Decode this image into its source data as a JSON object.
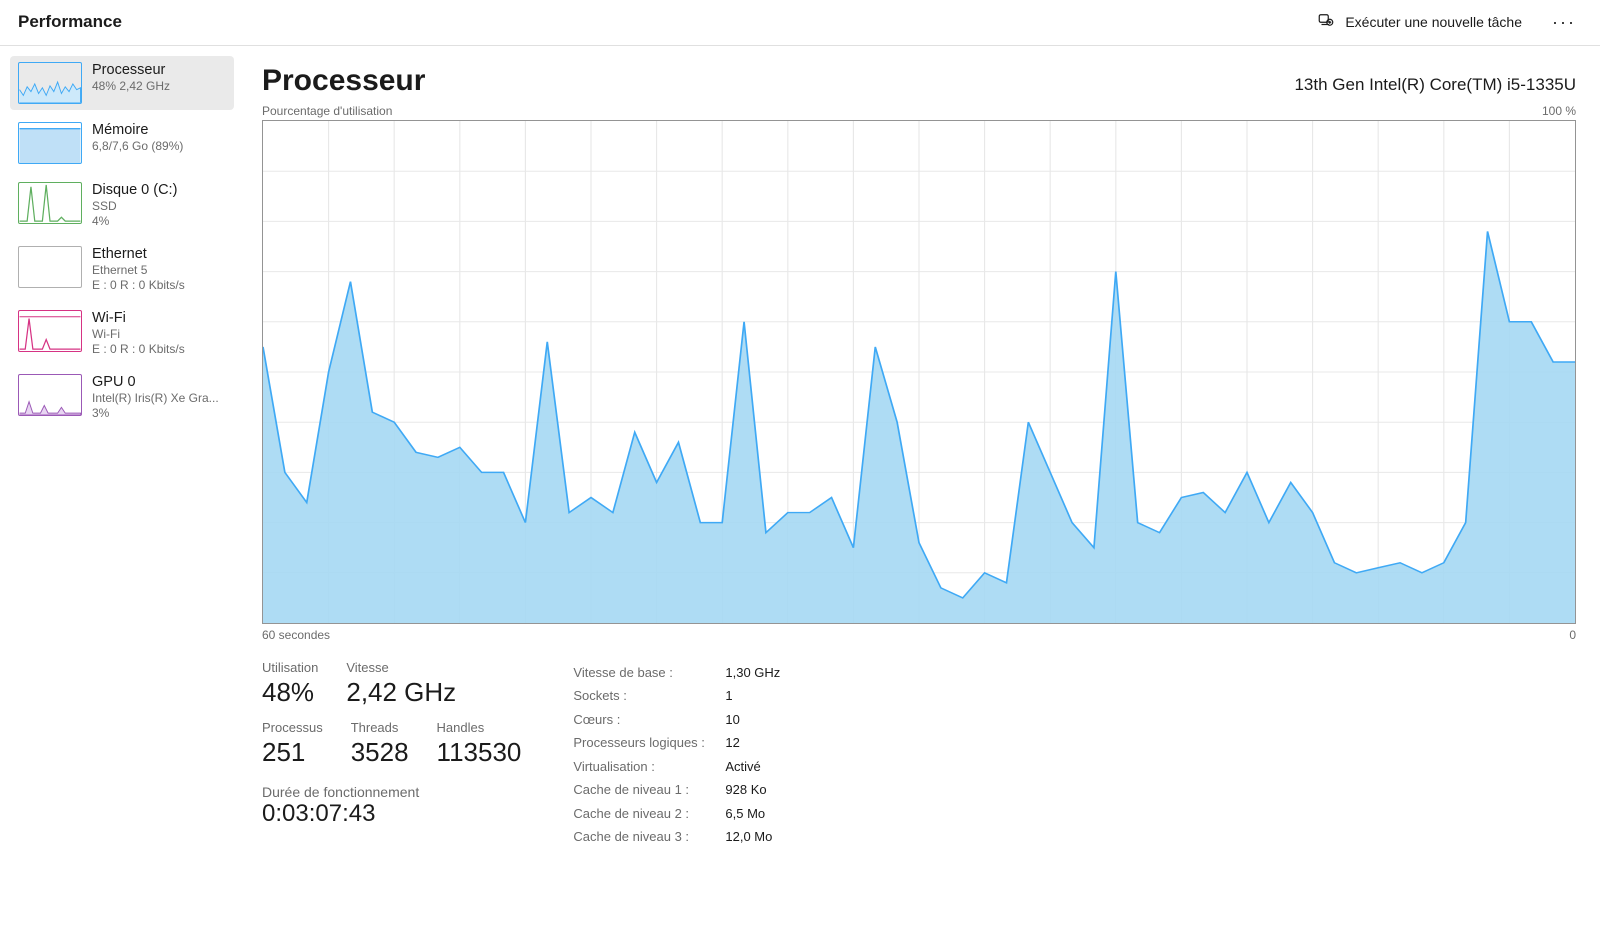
{
  "header": {
    "title": "Performance",
    "run_task_label": "Exécuter une nouvelle tâche",
    "more_label": "···"
  },
  "sidebar": [
    {
      "id": "cpu",
      "title": "Processeur",
      "sub1": "48%  2,42 GHz",
      "sub2": null,
      "selected": true,
      "thumb_border": "#3fa9f5",
      "thumb_kind": "cpu"
    },
    {
      "id": "memory",
      "title": "Mémoire",
      "sub1": "6,8/7,6 Go (89%)",
      "sub2": null,
      "selected": false,
      "thumb_border": "#3fa9f5",
      "thumb_kind": "memory"
    },
    {
      "id": "disk0",
      "title": "Disque 0 (C:)",
      "sub1": "SSD",
      "sub2": "4%",
      "selected": false,
      "thumb_border": "#5faf5f",
      "thumb_kind": "disk"
    },
    {
      "id": "ethernet",
      "title": "Ethernet",
      "sub1": "Ethernet 5",
      "sub2": "E : 0 R : 0 Kbits/s",
      "selected": false,
      "thumb_border": "#b0b0b0",
      "thumb_kind": "empty"
    },
    {
      "id": "wifi",
      "title": "Wi-Fi",
      "sub1": "Wi-Fi",
      "sub2": "E : 0 R : 0 Kbits/s",
      "selected": false,
      "thumb_border": "#d63384",
      "thumb_kind": "wifi"
    },
    {
      "id": "gpu0",
      "title": "GPU 0",
      "sub1": "Intel(R) Iris(R) Xe Gra...",
      "sub2": "3%",
      "selected": false,
      "thumb_border": "#9b59b6",
      "thumb_kind": "gpu"
    }
  ],
  "main": {
    "title": "Processeur",
    "subtitle": "13th Gen Intel(R) Core(TM) i5-1335U",
    "chart": {
      "top_left_label": "Pourcentage d'utilisation",
      "top_right_label": "100 %",
      "bottom_left_label": "60 secondes",
      "bottom_right_label": "0"
    },
    "big_stats_row1": [
      {
        "label": "Utilisation",
        "value": "48%"
      },
      {
        "label": "Vitesse",
        "value": "2,42 GHz"
      }
    ],
    "big_stats_row2": [
      {
        "label": "Processus",
        "value": "251"
      },
      {
        "label": "Threads",
        "value": "3528"
      },
      {
        "label": "Handles",
        "value": "113530"
      }
    ],
    "uptime_label": "Durée de fonctionnement",
    "uptime_value": "0:03:07:43",
    "detail_stats": [
      {
        "label": "Vitesse de base :",
        "value": "1,30 GHz"
      },
      {
        "label": "Sockets :",
        "value": "1"
      },
      {
        "label": "Cœurs :",
        "value": "10"
      },
      {
        "label": "Processeurs logiques :",
        "value": "12"
      },
      {
        "label": "Virtualisation :",
        "value": "Activé"
      },
      {
        "label": "Cache de niveau 1 :",
        "value": "928 Ko"
      },
      {
        "label": "Cache de niveau 2 :",
        "value": "6,5 Mo"
      },
      {
        "label": "Cache de niveau 3 :",
        "value": "12,0 Mo"
      }
    ]
  },
  "chart_data": {
    "type": "area",
    "title": "Pourcentage d'utilisation",
    "xlabel": "secondes",
    "ylabel": "Pourcentage d'utilisation",
    "xlim": [
      60,
      0
    ],
    "ylim": [
      0,
      100
    ],
    "x": [
      60,
      59,
      58,
      57,
      56,
      55,
      54,
      53,
      52,
      51,
      50,
      49,
      48,
      47,
      46,
      45,
      44,
      43,
      42,
      41,
      40,
      39,
      38,
      37,
      36,
      35,
      34,
      33,
      32,
      31,
      30,
      29,
      28,
      27,
      26,
      25,
      24,
      23,
      22,
      21,
      20,
      19,
      18,
      17,
      16,
      15,
      14,
      13,
      12,
      11,
      10,
      9,
      8,
      7,
      6,
      5,
      4,
      3,
      2,
      1,
      0
    ],
    "values": [
      55,
      30,
      24,
      50,
      68,
      42,
      40,
      34,
      33,
      35,
      30,
      30,
      20,
      56,
      22,
      25,
      22,
      38,
      28,
      36,
      20,
      20,
      60,
      18,
      22,
      22,
      25,
      15,
      55,
      40,
      16,
      7,
      5,
      10,
      8,
      40,
      30,
      20,
      15,
      70,
      20,
      18,
      25,
      26,
      22,
      30,
      20,
      28,
      22,
      12,
      10,
      11,
      12,
      10,
      12,
      20,
      78,
      60,
      60,
      52,
      52
    ],
    "stroke": "#3fa9f5",
    "fill": "#a5d8f3"
  }
}
